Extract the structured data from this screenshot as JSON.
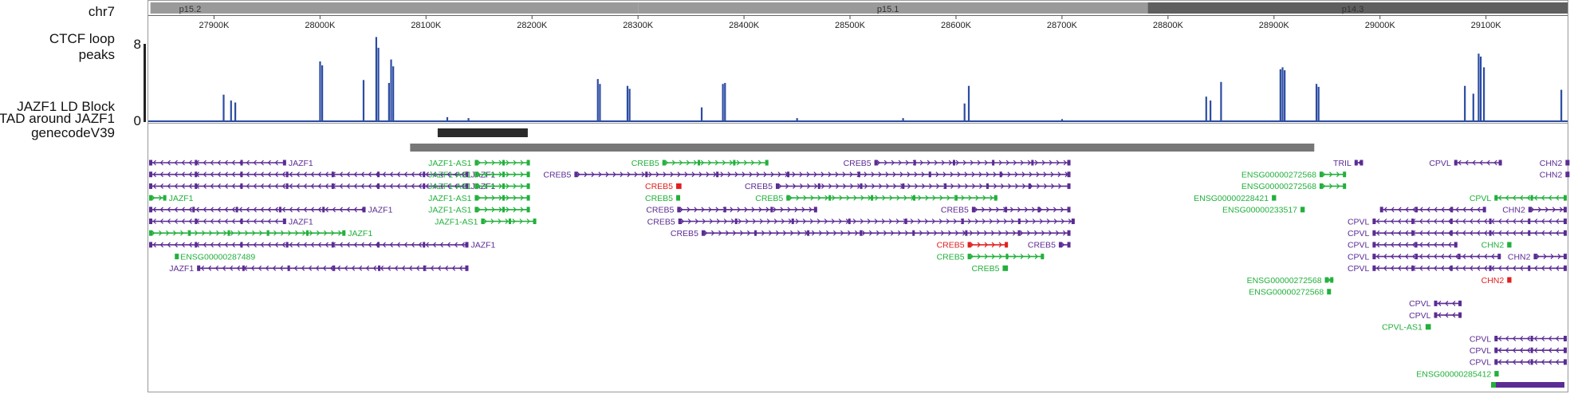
{
  "track_labels": {
    "chrom": "chr7",
    "ctcf_line1": "CTCF loop",
    "ctcf_line2": "peaks",
    "ctcf_max": "8",
    "ctcf_min": "0",
    "ld": "JAZF1 LD Block",
    "tad": "TAD around JAZF1",
    "genes": "genecodeV39"
  },
  "colors": {
    "coding": "#5b2c94",
    "noncoding": "#22b03c",
    "other": "#e02020",
    "signal": "#2c4ca2",
    "ideogram_light": "#9a9a9a",
    "ideogram_dark": "#5f5f5f",
    "ld_block": "#2b2b2b",
    "tad": "#777777"
  },
  "ideogram": {
    "bands": [
      {
        "label": "p15.2",
        "start": 27840000,
        "end": 28300000,
        "shade": "light"
      },
      {
        "label": "p15.1",
        "start": 28300000,
        "end": 28781000,
        "shade": "light"
      },
      {
        "label": "p14.3",
        "start": 28781000,
        "end": 29180000,
        "shade": "dark"
      }
    ]
  },
  "axis": {
    "start": 27838000,
    "end": 29177000,
    "ticks": [
      {
        "pos": 27900000,
        "label": "27900K"
      },
      {
        "pos": 28000000,
        "label": "28000K"
      },
      {
        "pos": 28100000,
        "label": "28100K"
      },
      {
        "pos": 28200000,
        "label": "28200K"
      },
      {
        "pos": 28300000,
        "label": "28300K"
      },
      {
        "pos": 28400000,
        "label": "28400K"
      },
      {
        "pos": 28500000,
        "label": "28500K"
      },
      {
        "pos": 28600000,
        "label": "28600K"
      },
      {
        "pos": 28700000,
        "label": "28700K"
      },
      {
        "pos": 28800000,
        "label": "28800K"
      },
      {
        "pos": 28900000,
        "label": "28900K"
      },
      {
        "pos": 29000000,
        "label": "29000K"
      },
      {
        "pos": 29100000,
        "label": "29100K"
      }
    ]
  },
  "chart_data": {
    "type": "bar",
    "ylim": [
      0,
      8
    ],
    "peaks": [
      [
        27909000,
        2.8
      ],
      [
        27916000,
        2.2
      ],
      [
        27920000,
        2.0
      ],
      [
        28000000,
        6.2
      ],
      [
        28002000,
        5.8
      ],
      [
        28041000,
        4.3
      ],
      [
        28053000,
        8.7
      ],
      [
        28055000,
        7.6
      ],
      [
        28065000,
        4.0
      ],
      [
        28067000,
        6.4
      ],
      [
        28069000,
        5.7
      ],
      [
        28120000,
        0.5
      ],
      [
        28140000,
        0.4
      ],
      [
        28262000,
        4.4
      ],
      [
        28264000,
        3.9
      ],
      [
        28290000,
        3.7
      ],
      [
        28292000,
        3.4
      ],
      [
        28360000,
        1.5
      ],
      [
        28380000,
        3.9
      ],
      [
        28382000,
        4.0
      ],
      [
        28450000,
        0.4
      ],
      [
        28550000,
        0.4
      ],
      [
        28608000,
        1.9
      ],
      [
        28612000,
        3.7
      ],
      [
        28700000,
        0.3
      ],
      [
        28836000,
        2.6
      ],
      [
        28840000,
        2.2
      ],
      [
        28850000,
        4.1
      ],
      [
        28906000,
        5.4
      ],
      [
        28908000,
        5.6
      ],
      [
        28910000,
        5.3
      ],
      [
        28940000,
        3.9
      ],
      [
        28942000,
        3.6
      ],
      [
        29080000,
        3.7
      ],
      [
        29088000,
        2.9
      ],
      [
        29093000,
        7.0
      ],
      [
        29095000,
        6.7
      ],
      [
        29098000,
        5.6
      ],
      [
        29171000,
        3.3
      ]
    ]
  },
  "ld_block": {
    "start": 28111000,
    "end": 28196000
  },
  "tad": {
    "start": 28085000,
    "end": 28938000
  },
  "genes": [
    {
      "row": 0,
      "s": 27838000,
      "e": 27968000,
      "str": "-",
      "t": "c",
      "label": "JAZF1",
      "lp": "r"
    },
    {
      "row": 0,
      "s": 28146000,
      "e": 28198000,
      "str": "+",
      "t": "n",
      "label": "JAZF1-AS1",
      "lp": "l"
    },
    {
      "row": 0,
      "s": 28323000,
      "e": 28423000,
      "str": "+",
      "t": "n",
      "label": "CREB5",
      "lp": "l"
    },
    {
      "row": 0,
      "s": 28523000,
      "e": 28708000,
      "str": "+",
      "t": "c",
      "label": "CREB5",
      "lp": "l"
    },
    {
      "row": 0,
      "s": 28976000,
      "e": 28984000,
      "str": "-",
      "t": "c",
      "label": "TRIL",
      "lp": "l"
    },
    {
      "row": 0,
      "s": 29070000,
      "e": 29115000,
      "str": "-",
      "t": "c",
      "label": "CPVL",
      "lp": "l"
    },
    {
      "row": 0,
      "s": 29175000,
      "e": 29177000,
      "str": "+",
      "t": "c",
      "label": "CHN2",
      "lp": "l"
    },
    {
      "row": 1,
      "s": 27838000,
      "e": 28140000,
      "str": "-",
      "t": "c",
      "label": "JAZF1",
      "lp": "r"
    },
    {
      "row": 1,
      "s": 28146000,
      "e": 28198000,
      "str": "+",
      "t": "n",
      "label": "JAZF1-AS1",
      "lp": "l"
    },
    {
      "row": 1,
      "s": 28240000,
      "e": 28708000,
      "str": "+",
      "t": "c",
      "label": "CREB5",
      "lp": "l"
    },
    {
      "row": 1,
      "s": 28943000,
      "e": 28968000,
      "str": "+",
      "t": "n",
      "label": "ENSG00000272568",
      "lp": "l"
    },
    {
      "row": 1,
      "s": 29175000,
      "e": 29177000,
      "str": "+",
      "t": "c",
      "label": "CHN2",
      "lp": "l"
    },
    {
      "row": 2,
      "s": 27838000,
      "e": 28140000,
      "str": "-",
      "t": "c",
      "label": "JAZF1",
      "lp": "r"
    },
    {
      "row": 2,
      "s": 28146000,
      "e": 28198000,
      "str": "+",
      "t": "n",
      "label": "JAZF1-AS1",
      "lp": "l"
    },
    {
      "row": 2,
      "s": 28336000,
      "e": 28341000,
      "str": "+",
      "t": "o",
      "label": "CREB5",
      "lp": "l"
    },
    {
      "row": 2,
      "s": 28430000,
      "e": 28708000,
      "str": "+",
      "t": "c",
      "label": "CREB5",
      "lp": "l"
    },
    {
      "row": 2,
      "s": 28943000,
      "e": 28968000,
      "str": "+",
      "t": "n",
      "label": "ENSG00000272568",
      "lp": "l"
    },
    {
      "row": 3,
      "s": 27838000,
      "e": 27855000,
      "str": "+",
      "t": "n",
      "label": "JAZF1",
      "lp": "r"
    },
    {
      "row": 3,
      "s": 28146000,
      "e": 28198000,
      "str": "+",
      "t": "n",
      "label": "JAZF1-AS1",
      "lp": "l"
    },
    {
      "row": 3,
      "s": 28336000,
      "e": 28339000,
      "str": "+",
      "t": "n",
      "label": "CREB5",
      "lp": "l"
    },
    {
      "row": 3,
      "s": 28440000,
      "e": 28639000,
      "str": "+",
      "t": "n",
      "label": "CREB5",
      "lp": "l"
    },
    {
      "row": 3,
      "s": 28898000,
      "e": 28902000,
      "str": "+",
      "t": "n",
      "label": "ENSG00000228421",
      "lp": "l"
    },
    {
      "row": 3,
      "s": 29108000,
      "e": 29177000,
      "str": "-",
      "t": "n",
      "label": "CPVL",
      "lp": "l"
    },
    {
      "row": 4,
      "s": 27838000,
      "e": 28043000,
      "str": "-",
      "t": "c",
      "label": "JAZF1",
      "lp": "r"
    },
    {
      "row": 4,
      "s": 28146000,
      "e": 28198000,
      "str": "+",
      "t": "n",
      "label": "JAZF1-AS1",
      "lp": "l"
    },
    {
      "row": 4,
      "s": 28337000,
      "e": 28469000,
      "str": "+",
      "t": "c",
      "label": "CREB5",
      "lp": "l"
    },
    {
      "row": 4,
      "s": 28615000,
      "e": 28708000,
      "str": "+",
      "t": "c",
      "label": "CREB5",
      "lp": "l"
    },
    {
      "row": 4,
      "s": 28925000,
      "e": 28929000,
      "str": "+",
      "t": "n",
      "label": "ENSG00000233517",
      "lp": "l"
    },
    {
      "row": 4,
      "s": 29000000,
      "e": 29100000,
      "str": "-",
      "t": "c",
      "label": "",
      "lp": "l"
    },
    {
      "row": 4,
      "s": 29140000,
      "e": 29177000,
      "str": "+",
      "t": "c",
      "label": "CHN2",
      "lp": "l"
    },
    {
      "row": 5,
      "s": 27838000,
      "e": 27968000,
      "str": "-",
      "t": "c",
      "label": "JAZF1",
      "lp": "r"
    },
    {
      "row": 5,
      "s": 28152000,
      "e": 28204000,
      "str": "+",
      "t": "n",
      "label": "JAZF1-AS1",
      "lp": "l"
    },
    {
      "row": 5,
      "s": 28338000,
      "e": 28712000,
      "str": "+",
      "t": "c",
      "label": "CREB5",
      "lp": "l"
    },
    {
      "row": 5,
      "s": 28993000,
      "e": 29177000,
      "str": "-",
      "t": "c",
      "label": "CPVL",
      "lp": "l"
    },
    {
      "row": 6,
      "s": 27838000,
      "e": 28024000,
      "str": "+",
      "t": "n",
      "label": "JAZF1",
      "lp": "r"
    },
    {
      "row": 6,
      "s": 28360000,
      "e": 28708000,
      "str": "+",
      "t": "c",
      "label": "CREB5",
      "lp": "l"
    },
    {
      "row": 6,
      "s": 28993000,
      "e": 29177000,
      "str": "-",
      "t": "c",
      "label": "CPVL",
      "lp": "l"
    },
    {
      "row": 7,
      "s": 27838000,
      "e": 28140000,
      "str": "-",
      "t": "c",
      "label": "JAZF1",
      "lp": "r"
    },
    {
      "row": 7,
      "s": 28611000,
      "e": 28649000,
      "str": "+",
      "t": "o",
      "label": "CREB5",
      "lp": "l"
    },
    {
      "row": 7,
      "s": 28697000,
      "e": 28708000,
      "str": "+",
      "t": "c",
      "label": "CREB5",
      "lp": "l"
    },
    {
      "row": 7,
      "s": 28993000,
      "e": 29073000,
      "str": "-",
      "t": "c",
      "label": "CPVL",
      "lp": "l"
    },
    {
      "row": 7,
      "s": 29120000,
      "e": 29124000,
      "str": "+",
      "t": "n",
      "label": "CHN2",
      "lp": "l"
    },
    {
      "row": 8,
      "s": 27863000,
      "e": 27866000,
      "str": "+",
      "t": "n",
      "label": "ENSG00000287489",
      "lp": "r"
    },
    {
      "row": 8,
      "s": 28611000,
      "e": 28683000,
      "str": "+",
      "t": "n",
      "label": "CREB5",
      "lp": "l"
    },
    {
      "row": 8,
      "s": 28993000,
      "e": 29114000,
      "str": "-",
      "t": "c",
      "label": "CPVL",
      "lp": "l"
    },
    {
      "row": 8,
      "s": 29145000,
      "e": 29177000,
      "str": "+",
      "t": "c",
      "label": "CHN2",
      "lp": "l"
    },
    {
      "row": 9,
      "s": 27884000,
      "e": 28140000,
      "str": "-",
      "t": "c",
      "label": "JAZF1",
      "lp": "l"
    },
    {
      "row": 9,
      "s": 28644000,
      "e": 28649000,
      "str": "+",
      "t": "n",
      "label": "CREB5",
      "lp": "l"
    },
    {
      "row": 9,
      "s": 28993000,
      "e": 29177000,
      "str": "-",
      "t": "c",
      "label": "CPVL",
      "lp": "l"
    },
    {
      "row": 10,
      "s": 28948000,
      "e": 28956000,
      "str": "+",
      "t": "n",
      "label": "ENSG00000272568",
      "lp": "l"
    },
    {
      "row": 10,
      "s": 29120000,
      "e": 29124000,
      "str": "+",
      "t": "o",
      "label": "CHN2",
      "lp": "l"
    },
    {
      "row": 11,
      "s": 28950000,
      "e": 28953000,
      "str": "+",
      "t": "n",
      "label": "ENSG00000272568",
      "lp": "l"
    },
    {
      "row": 12,
      "s": 29051000,
      "e": 29077000,
      "str": "-",
      "t": "c",
      "label": "CPVL",
      "lp": "l"
    },
    {
      "row": 13,
      "s": 29051000,
      "e": 29077000,
      "str": "-",
      "t": "c",
      "label": "CPVL",
      "lp": "l"
    },
    {
      "row": 14,
      "s": 29043000,
      "e": 29048000,
      "str": "+",
      "t": "n",
      "label": "CPVL-AS1",
      "lp": "l"
    },
    {
      "row": 15,
      "s": 29108000,
      "e": 29177000,
      "str": "-",
      "t": "c",
      "label": "CPVL",
      "lp": "l"
    },
    {
      "row": 16,
      "s": 29108000,
      "e": 29177000,
      "str": "-",
      "t": "c",
      "label": "CPVL",
      "lp": "l"
    },
    {
      "row": 17,
      "s": 29108000,
      "e": 29177000,
      "str": "-",
      "t": "c",
      "label": "CPVL",
      "lp": "l"
    },
    {
      "row": 18,
      "s": 29108000,
      "e": 29112000,
      "str": "+",
      "t": "n",
      "label": "ENSG00000285412",
      "lp": "l"
    }
  ]
}
